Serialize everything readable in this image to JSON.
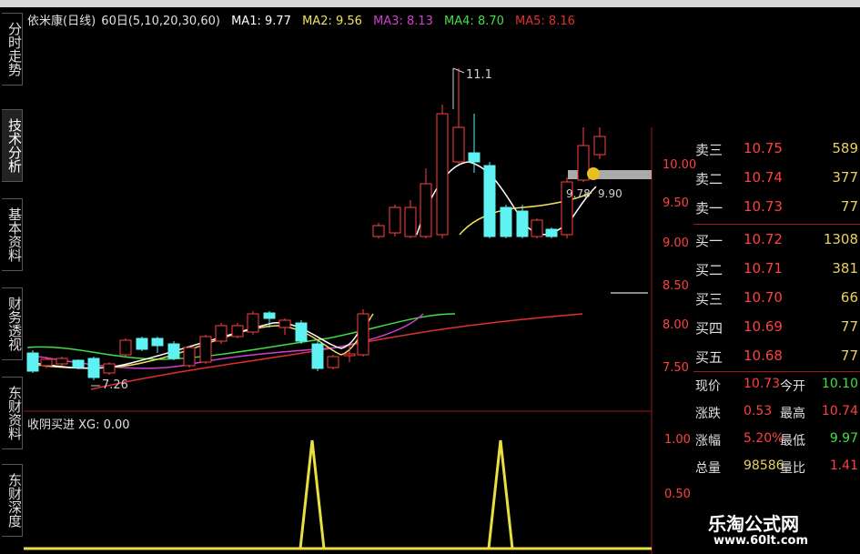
{
  "top_info": {
    "stock_title": "依米康(日线)",
    "ma_params": "60日(5,10,20,30,60)",
    "ma1": "MA1: 9.77",
    "ma2": "MA2: 9.56",
    "ma3": "MA3: 8.13",
    "ma4": "MA4: 8.70",
    "ma5": "MA5: 8.16",
    "arrow": "↑"
  },
  "side_tabs": [
    "分时走势",
    "技术分析",
    "基本资料",
    "财务透视",
    "东财资料",
    "东财深度"
  ],
  "indicator": {
    "label": "收阴买进 XG: 0.00"
  },
  "price_axis": [
    "10.00",
    "9.50",
    "9.00",
    "8.50",
    "8.00",
    "7.50"
  ],
  "indicator_axis": [
    "1.00",
    "0.50"
  ],
  "annotations": {
    "high_label": "11.1",
    "low_label": "7.26",
    "mid_label1": "9.78",
    "mid_label2": "9.90"
  },
  "order_book": {
    "sells": [
      {
        "label": "卖三",
        "price": "10.75",
        "volume": "589"
      },
      {
        "label": "卖二",
        "price": "10.74",
        "volume": "377"
      },
      {
        "label": "卖一",
        "price": "10.73",
        "volume": "77"
      }
    ],
    "buys": [
      {
        "label": "买一",
        "price": "10.72",
        "volume": "1308"
      },
      {
        "label": "买二",
        "price": "10.71",
        "volume": "381"
      },
      {
        "label": "买三",
        "price": "10.70",
        "volume": "66"
      },
      {
        "label": "买四",
        "price": "10.69",
        "volume": "77"
      },
      {
        "label": "买五",
        "price": "10.68",
        "volume": "77"
      }
    ]
  },
  "stats": [
    {
      "k1": "现价",
      "v1": "10.73",
      "k2": "今开",
      "v2": "10.10"
    },
    {
      "k1": "涨跌",
      "v1": "0.53",
      "k2": "最高",
      "v2": "10.74"
    },
    {
      "k1": "涨幅",
      "v1": "5.20%",
      "k2": "最低",
      "v2": "9.97"
    },
    {
      "k1": "总量",
      "v1": "98586",
      "k2": "量比",
      "v2": "1.41"
    }
  ],
  "watermark": {
    "title": "乐淘公式网",
    "url": "www.60lt.com"
  },
  "colors": {
    "up": "#ff4040",
    "down": "#5ef2f2",
    "ma1": "#ffffff",
    "ma2": "#f0e060",
    "ma3": "#d040d0",
    "ma4": "#40e040",
    "ma5": "#e03030"
  }
}
